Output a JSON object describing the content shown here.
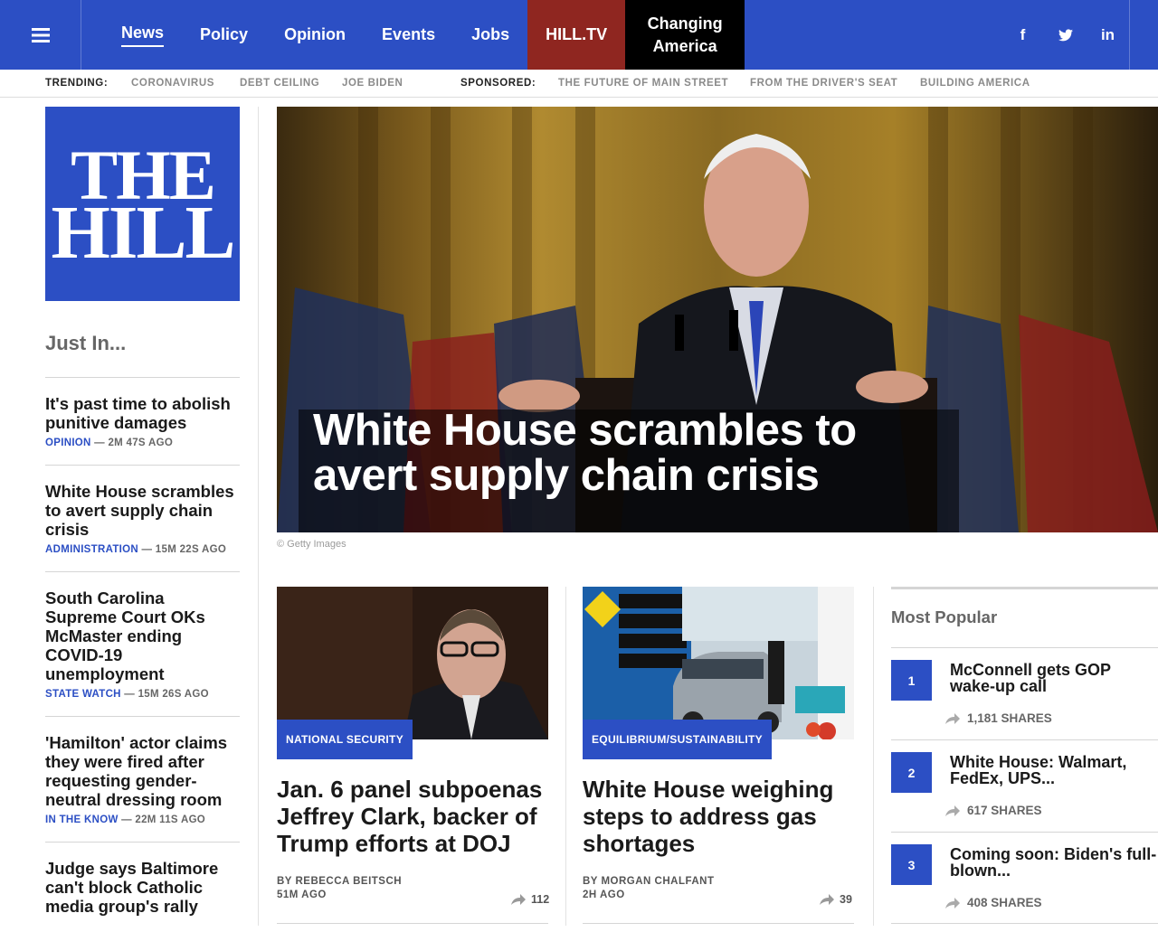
{
  "nav": {
    "items": [
      {
        "label": "News"
      },
      {
        "label": "Policy"
      },
      {
        "label": "Opinion"
      },
      {
        "label": "Events"
      },
      {
        "label": "Jobs"
      },
      {
        "label": "HILL.TV"
      }
    ],
    "changing_line1": "Changing",
    "changing_line2": "America",
    "social": [
      "facebook-icon",
      "twitter-icon",
      "linkedin-icon"
    ],
    "social_glyphs": {
      "facebook": "f",
      "linkedin": "in"
    },
    "colors": {
      "brand_blue": "#2c4fc4",
      "hilltv_red": "#8f2620",
      "black": "#000000"
    }
  },
  "trending": {
    "label": "TRENDING:",
    "links": [
      "CORONAVIRUS",
      "DEBT CEILING",
      "JOE BIDEN"
    ],
    "sponsored_label": "SPONSORED:",
    "sponsored_links": [
      "THE FUTURE OF MAIN STREET",
      "FROM THE DRIVER'S SEAT",
      "BUILDING AMERICA"
    ]
  },
  "logo": {
    "line1": "THE",
    "line2": "HILL"
  },
  "just_in": {
    "title": "Just In...",
    "items": [
      {
        "title": "It's past time to abolish punitive damages",
        "category": "OPINION",
        "time": " — 2M 47S AGO"
      },
      {
        "title": "White House scrambles to avert supply chain crisis",
        "category": "ADMINISTRATION",
        "time": " — 15M 22S AGO"
      },
      {
        "title": "South Carolina Supreme Court OKs McMaster ending COVID-19 unemployment",
        "category": "STATE WATCH",
        "time": " — 15M 26S AGO"
      },
      {
        "title": "'Hamilton' actor claims they were fired after requesting gender-neutral dressing room",
        "category": "IN THE KNOW",
        "time": " — 22M 11S AGO"
      },
      {
        "title": "Judge says Baltimore can't block Catholic media group's rally",
        "category": "",
        "time": ""
      }
    ]
  },
  "hero": {
    "title": "White House scrambles to avert supply chain crisis",
    "credit": "© Getty Images"
  },
  "cards": [
    {
      "category": "NATIONAL SECURITY",
      "title": "Jan. 6 panel subpoenas Jeffrey Clark, backer of Trump efforts at DOJ",
      "byline": "BY REBECCA BEITSCH",
      "time": "51M AGO",
      "shares": "112"
    },
    {
      "category": "EQUILIBRIUM/SUSTAINABILITY",
      "title": "White House weighing steps to address gas shortages",
      "byline": "BY MORGAN CHALFANT",
      "time": "2H AGO",
      "shares": "39"
    }
  ],
  "most_popular": {
    "title": "Most Popular",
    "items": [
      {
        "num": "1",
        "line1": "McConnell gets GOP",
        "line2": "wake-up call",
        "shares": "1,181 SHARES"
      },
      {
        "num": "2",
        "line1": "White House: Walmart,",
        "line2": "FedEx, UPS...",
        "shares": "617 SHARES"
      },
      {
        "num": "3",
        "line1": "Coming soon: Biden's full-",
        "line2": "blown...",
        "shares": "408 SHARES"
      }
    ]
  }
}
